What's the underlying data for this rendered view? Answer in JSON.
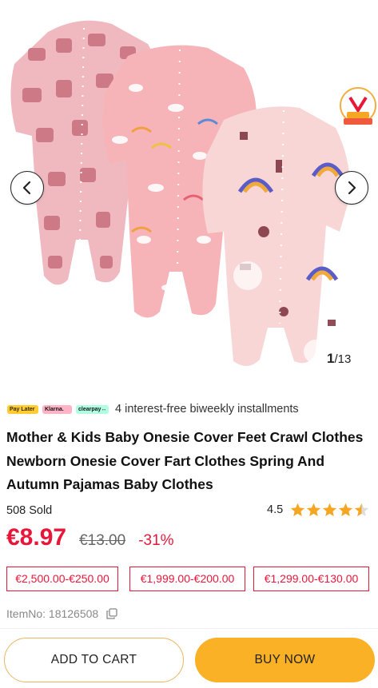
{
  "gallery": {
    "current": "1",
    "total": "/13",
    "image_alt": "Three pink baby footed onesies"
  },
  "pay_options": {
    "badges": [
      "Pay Later",
      "Klarna.",
      "clearpay↔"
    ],
    "text": "4 interest-free biweekly installments"
  },
  "product": {
    "title": "Mother & Kids Baby Onesie Cover Feet Crawl Clothes Newborn Onesie Cover Fart Clothes Spring And Autumn Pajamas Baby Clothes",
    "sold": "508 Sold",
    "rating": "4.5",
    "rating_stars": 4.5,
    "price": "€8.97",
    "original_price": "€13.00",
    "discount": "-31%",
    "price_tiers": [
      "€2,500.00-€250.00",
      "€1,999.00-€200.00",
      "€1,299.00-€130.00"
    ],
    "item_no": "ItemNo: 18126508"
  },
  "actions": {
    "add_to_cart": "ADD TO CART",
    "buy_now": "BUY NOW"
  },
  "colors": {
    "accent_red": "#e8173a",
    "buy_yellow": "#fbb125",
    "star": "#f5a623"
  },
  "icons": [
    "chevron-left-icon",
    "chevron-right-icon",
    "star-icon",
    "copy-icon",
    "vegitian-badge-icon"
  ]
}
